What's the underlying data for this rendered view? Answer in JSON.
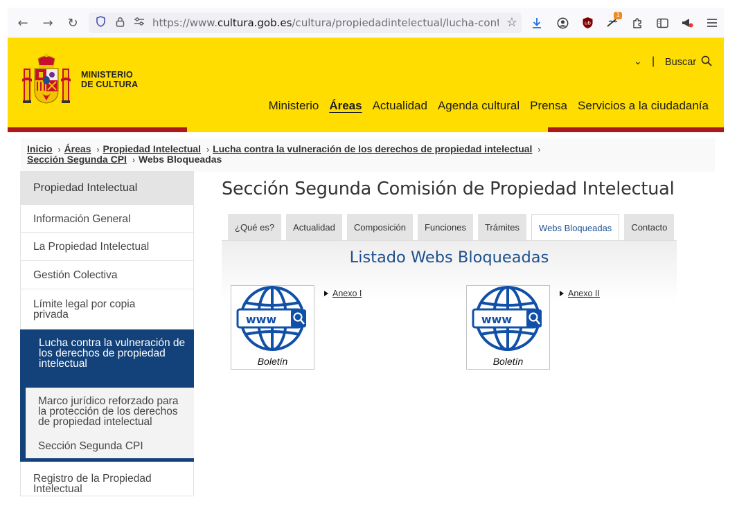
{
  "browser": {
    "url_host": "https://www.",
    "url_domain": "cultura.gob.es",
    "url_path": "/cultura/propiedadintelectual/lucha-contra-la",
    "badge_count": "1"
  },
  "header": {
    "ministry_line1": "MINISTERIO",
    "ministry_line2": "DE CULTURA",
    "lang_chevron": "⌄",
    "separator": "|",
    "search_label": "Buscar",
    "nav": [
      "Ministerio",
      "Áreas",
      "Actualidad",
      "Agenda cultural",
      "Prensa",
      "Servicios a la ciudadanía"
    ],
    "colors": {
      "yellow": "#ffdd00",
      "red": "#ab1a1a",
      "navy": "#13427a"
    }
  },
  "breadcrumb": {
    "items": [
      "Inicio",
      "Áreas",
      "Propiedad Intelectual",
      "Lucha contra la vulneración de los derechos de propiedad intelectual",
      "Sección Segunda CPI"
    ],
    "current": "Webs Bloqueadas",
    "separator": "›"
  },
  "sidebar": {
    "heading": "Propiedad Intelectual",
    "items": [
      "Información General",
      "La Propiedad Intelectual",
      "Gestión Colectiva",
      "Límite legal por copia privada"
    ],
    "active": "Lucha contra la vulneración de los derechos de propiedad intelectual",
    "sub_items": [
      "Marco jurídico reforzado para la protección de los derechos de propiedad intelectual",
      "Sección Segunda CPI"
    ],
    "after": "Registro de la Propiedad Intelectual"
  },
  "main": {
    "title": "Sección Segunda Comisión de Propiedad Intelectual",
    "tabs": [
      "¿Qué es?",
      "Actualidad",
      "Composición",
      "Funciones",
      "Trámites",
      "Webs Bloqueadas",
      "Contacto"
    ],
    "active_tab": "Webs Bloqueadas",
    "panel_title": "Listado Webs Bloqueadas",
    "cards": [
      {
        "caption": "Boletín",
        "link": "Anexo I",
        "icon_text": "www"
      },
      {
        "caption": "Boletín",
        "link": "Anexo II",
        "icon_text": "www"
      }
    ]
  }
}
